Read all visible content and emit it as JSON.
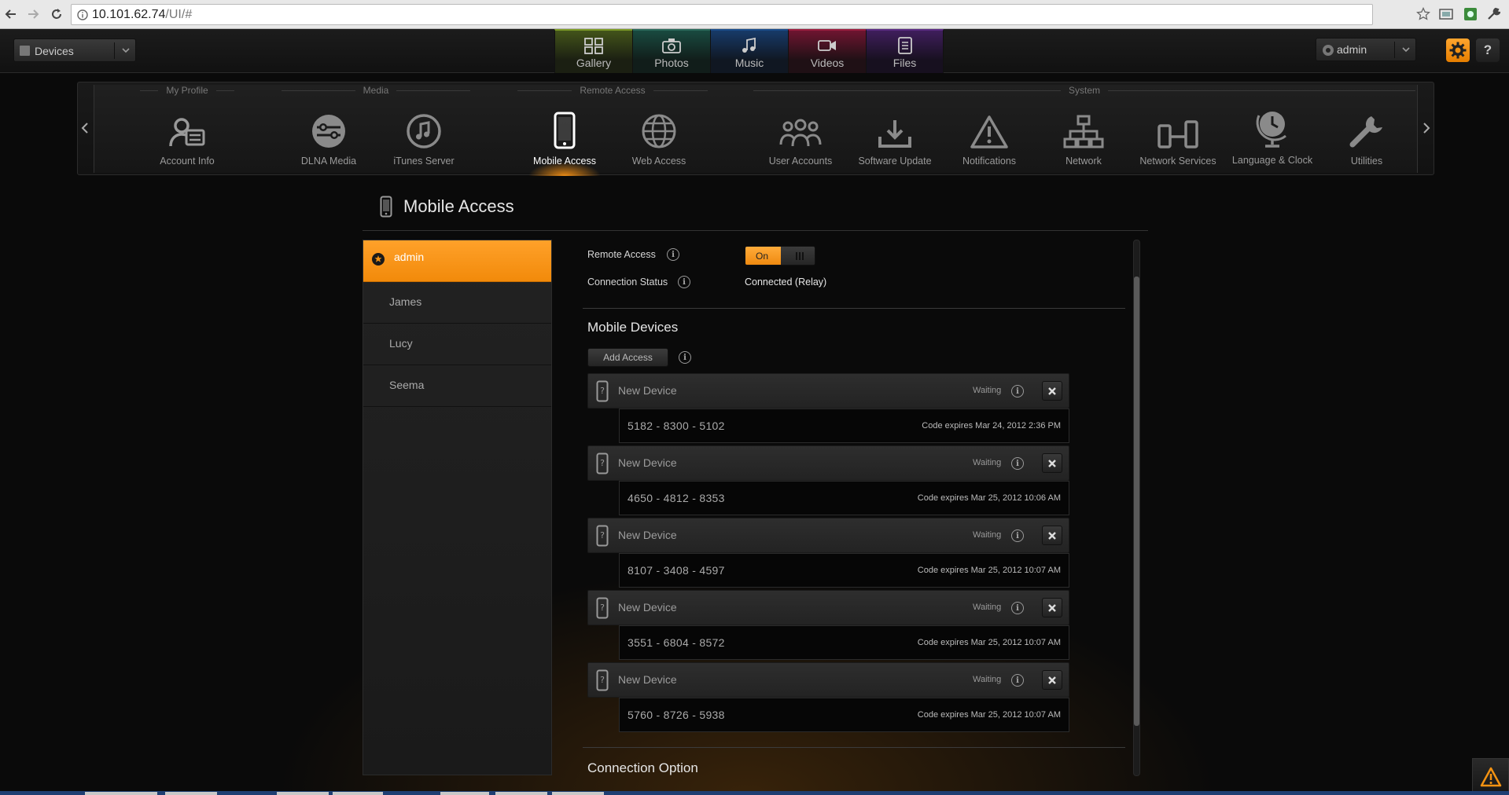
{
  "browser": {
    "url_host": "10.101.62.74",
    "url_path": "/UI/#"
  },
  "header": {
    "devices_label": "Devices",
    "media_tabs": [
      {
        "label": "Gallery",
        "color": "#7d9b28"
      },
      {
        "label": "Photos",
        "color": "#2c6a5c"
      },
      {
        "label": "Music",
        "color": "#1b4d8a"
      },
      {
        "label": "Videos",
        "color": "#9b1f3f"
      },
      {
        "label": "Files",
        "color": "#5b2c82"
      }
    ],
    "user_label": "admin",
    "help_label": "?"
  },
  "carousel": {
    "groups": [
      "My Profile",
      "Media",
      "Remote Access",
      "System"
    ],
    "items": [
      {
        "label": "Account Info",
        "icon": "account-info-icon"
      },
      {
        "label": "DLNA Media",
        "icon": "dlna-media-icon"
      },
      {
        "label": "iTunes Server",
        "icon": "itunes-icon"
      },
      {
        "label": "Mobile Access",
        "icon": "mobile-icon"
      },
      {
        "label": "Web Access",
        "icon": "globe-icon"
      },
      {
        "label": "User Accounts",
        "icon": "users-icon"
      },
      {
        "label": "Software Update",
        "icon": "download-icon"
      },
      {
        "label": "Notifications",
        "icon": "warning-icon"
      },
      {
        "label": "Network",
        "icon": "network-icon"
      },
      {
        "label": "Network Services",
        "icon": "network-services-icon"
      },
      {
        "label": "Language & Clock",
        "icon": "globe-clock-icon"
      },
      {
        "label": "Utilities",
        "icon": "wrench-icon"
      }
    ],
    "active_index": 3
  },
  "page": {
    "title": "Mobile Access"
  },
  "users": [
    "admin",
    "James",
    "Lucy",
    "Seema"
  ],
  "remote_access": {
    "label": "Remote Access",
    "toggle": "On"
  },
  "connection_status": {
    "label": "Connection Status",
    "value": "Connected (Relay)"
  },
  "mobile_devices": {
    "heading": "Mobile Devices",
    "add_label": "Add Access",
    "devices": [
      {
        "name": "New Device",
        "status": "Waiting",
        "code": "5182 - 8300 - 5102",
        "expires": "Code expires Mar 24, 2012 2:36 PM"
      },
      {
        "name": "New Device",
        "status": "Waiting",
        "code": "4650 - 4812 - 8353",
        "expires": "Code expires Mar 25, 2012 10:06 AM"
      },
      {
        "name": "New Device",
        "status": "Waiting",
        "code": "8107 - 3408 - 4597",
        "expires": "Code expires Mar 25, 2012 10:07 AM"
      },
      {
        "name": "New Device",
        "status": "Waiting",
        "code": "3551 - 6804 - 8572",
        "expires": "Code expires Mar 25, 2012 10:07 AM"
      },
      {
        "name": "New Device",
        "status": "Waiting",
        "code": "5760 - 8726 - 5938",
        "expires": "Code expires Mar 25, 2012 10:07 AM"
      }
    ]
  },
  "connection_option": {
    "heading": "Connection Option"
  },
  "colors": {
    "accent": "#f39212",
    "background": "#0a0a0a"
  }
}
